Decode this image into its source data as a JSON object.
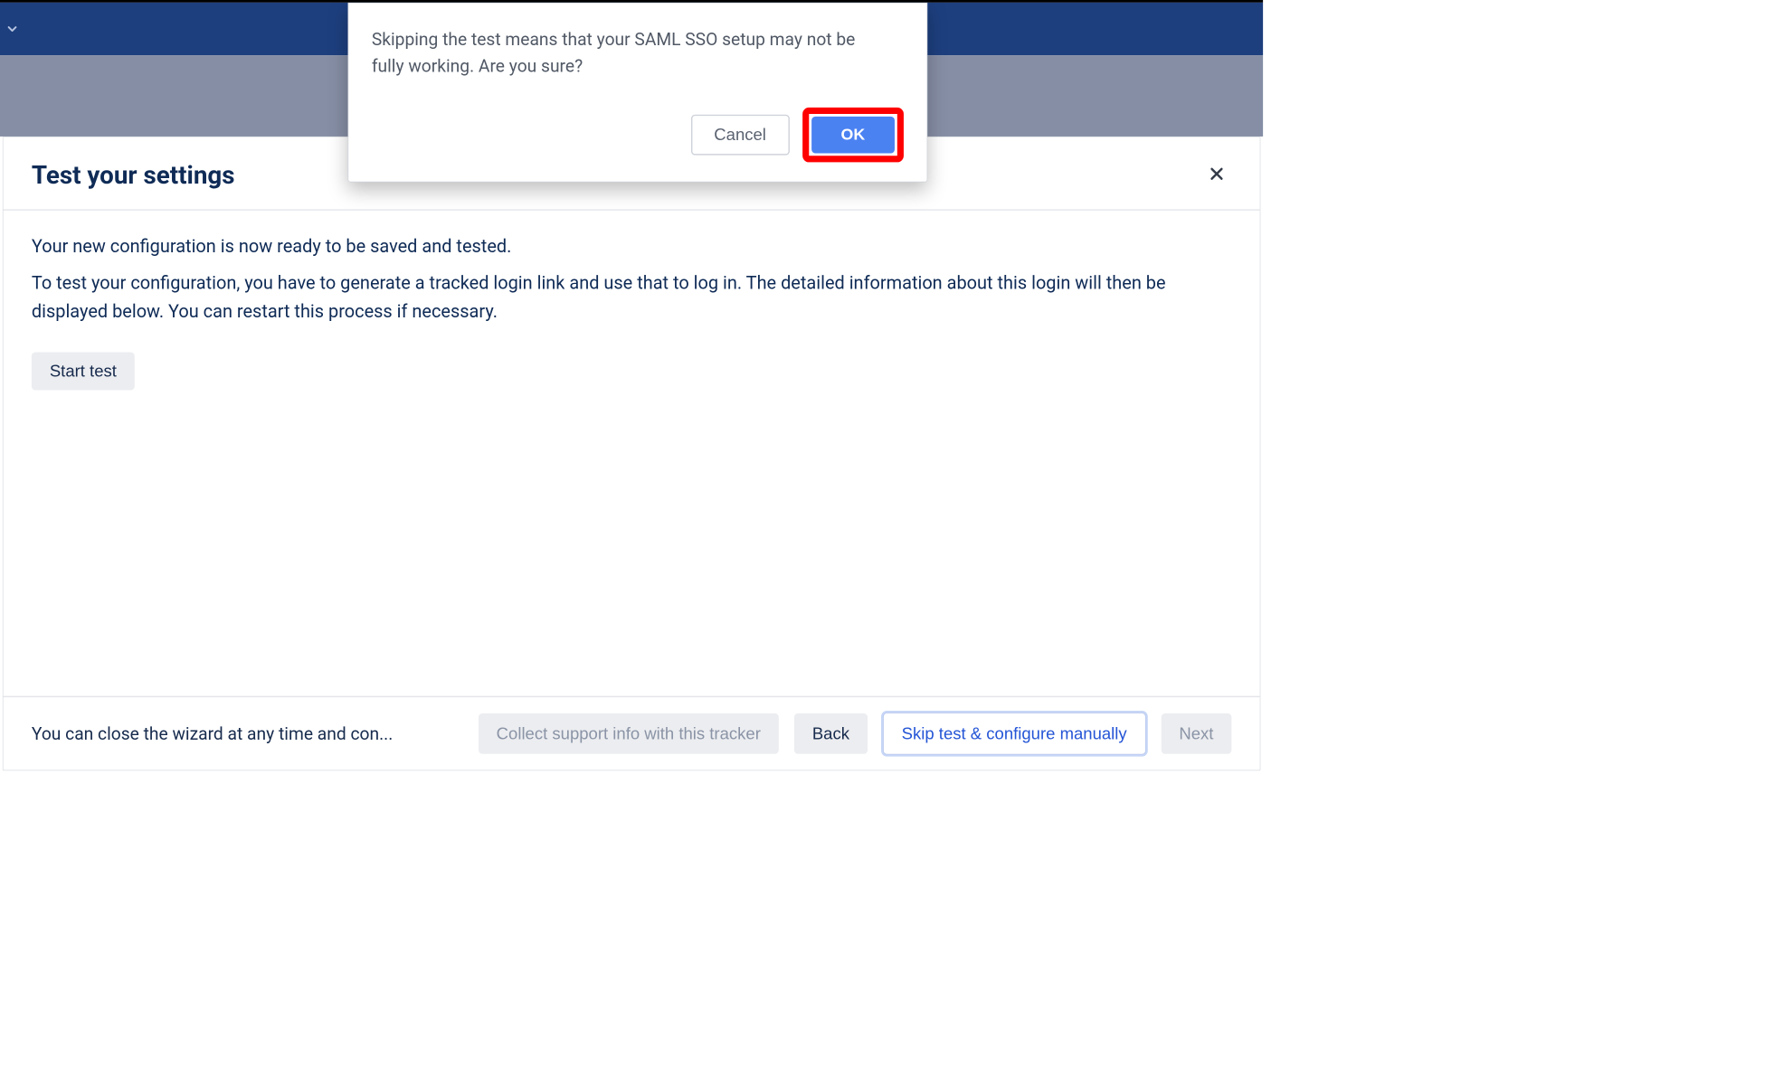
{
  "modal": {
    "message": "Skipping the test means that your SAML SSO setup may not be fully working. Are you sure?",
    "cancel_label": "Cancel",
    "ok_label": "OK"
  },
  "panel": {
    "title": "Test your settings",
    "line1": "Your new configuration is now ready to be saved and tested.",
    "line2": "To test your configuration, you have to generate a tracked login link and use that to log in. The detailed information about this login will then be displayed below. You can restart this process if necessary.",
    "start_test_label": "Start test"
  },
  "footer": {
    "hint": "You can close the wizard at any time and con...",
    "collect_label": "Collect support info with this tracker",
    "back_label": "Back",
    "skip_label": "Skip test & configure manually",
    "next_label": "Next"
  }
}
